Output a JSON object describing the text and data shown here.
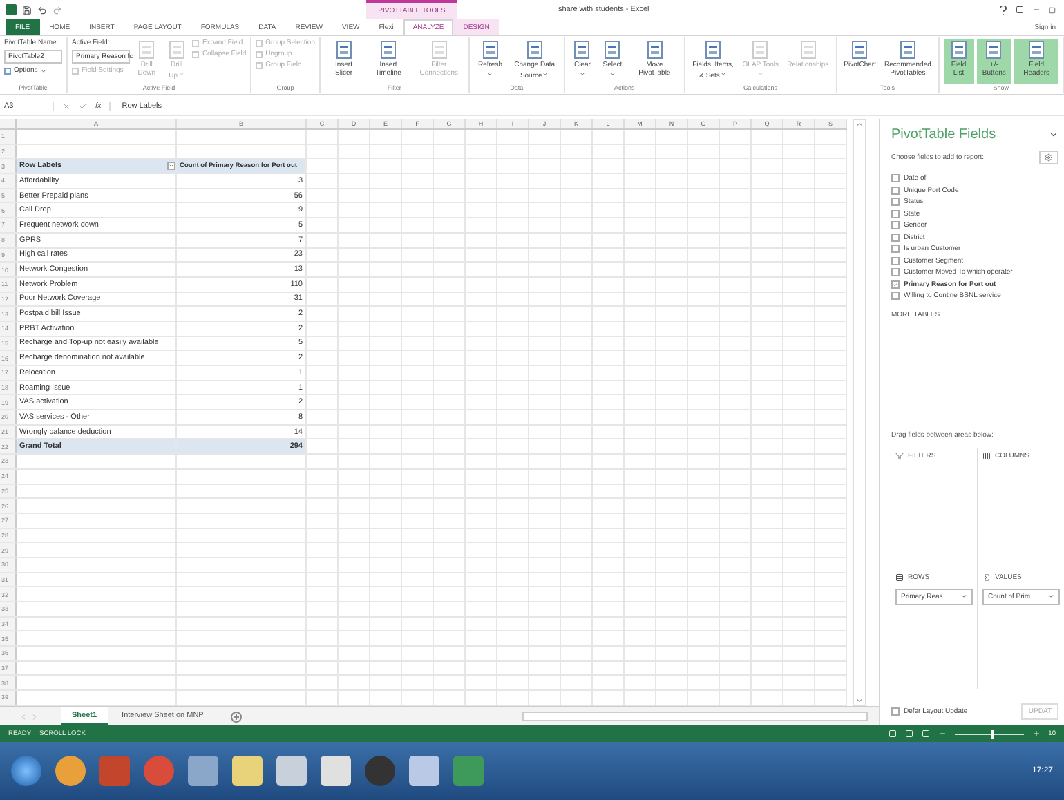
{
  "title_bar": {
    "context_tab": "PIVOTTABLE TOOLS",
    "title": "share with students - Excel"
  },
  "tabs": [
    {
      "label": "FILE",
      "kind": "file",
      "selected": false
    },
    {
      "label": "HOME",
      "kind": "plain",
      "selected": false
    },
    {
      "label": "INSERT",
      "kind": "plain",
      "selected": false
    },
    {
      "label": "PAGE LAYOUT",
      "kind": "plain",
      "selected": false
    },
    {
      "label": "FORMULAS",
      "kind": "plain",
      "selected": false
    },
    {
      "label": "DATA",
      "kind": "plain",
      "selected": false
    },
    {
      "label": "REVIEW",
      "kind": "plain",
      "selected": false
    },
    {
      "label": "VIEW",
      "kind": "plain",
      "selected": false
    },
    {
      "label": "Flexi",
      "kind": "plain",
      "selected": false
    },
    {
      "label": "ANALYZE",
      "kind": "context",
      "selected": true
    },
    {
      "label": "DESIGN",
      "kind": "context",
      "selected": false
    }
  ],
  "sign_in": "Sign in",
  "ribbon": [
    {
      "label": "PivotTable",
      "columns": [
        [
          {
            "kind": "caption",
            "label": "PivotTable Name:"
          },
          {
            "kind": "input",
            "label": "PivotTable2"
          },
          {
            "kind": "small",
            "label": "Options",
            "dropdown": true,
            "disabled": false
          }
        ]
      ]
    },
    {
      "label": "Active Field",
      "columns": [
        [
          {
            "kind": "caption",
            "label": "Active Field:"
          },
          {
            "kind": "input",
            "label": "Primary Reason fc"
          },
          {
            "kind": "small",
            "label": "Field Settings",
            "dropdown": false,
            "disabled": true
          }
        ],
        [
          {
            "kind": "large",
            "label": "Drill Down",
            "dropdown": false,
            "disabled": true
          }
        ],
        [
          {
            "kind": "large",
            "label": "Drill Up",
            "dropdown": true,
            "disabled": true
          }
        ],
        [
          {
            "kind": "small",
            "label": "Expand Field",
            "dropdown": false,
            "disabled": true
          },
          {
            "kind": "small",
            "label": "Collapse Field",
            "dropdown": false,
            "disabled": true
          }
        ]
      ]
    },
    {
      "label": "Group",
      "columns": [
        [
          {
            "kind": "small",
            "label": "Group Selection",
            "dropdown": false,
            "disabled": true
          },
          {
            "kind": "small",
            "label": "Ungroup",
            "dropdown": false,
            "disabled": true
          },
          {
            "kind": "small",
            "label": "Group Field",
            "dropdown": false,
            "disabled": true
          }
        ]
      ]
    },
    {
      "label": "Filter",
      "columns": [
        [
          {
            "kind": "large",
            "label": "Insert Slicer",
            "dropdown": false,
            "disabled": false
          }
        ],
        [
          {
            "kind": "large",
            "label": "Insert Timeline",
            "dropdown": false,
            "disabled": false
          }
        ],
        [
          {
            "kind": "large",
            "label": "Filter Connections",
            "dropdown": false,
            "disabled": true
          }
        ]
      ]
    },
    {
      "label": "Data",
      "columns": [
        [
          {
            "kind": "large",
            "label": "Refresh",
            "dropdown": true,
            "disabled": false
          }
        ],
        [
          {
            "kind": "large",
            "label": "Change Data Source",
            "dropdown": true,
            "disabled": false
          }
        ]
      ]
    },
    {
      "label": "Actions",
      "columns": [
        [
          {
            "kind": "large",
            "label": "Clear",
            "dropdown": true,
            "disabled": false
          }
        ],
        [
          {
            "kind": "large",
            "label": "Select",
            "dropdown": true,
            "disabled": false
          }
        ],
        [
          {
            "kind": "large",
            "label": "Move PivotTable",
            "dropdown": false,
            "disabled": false
          }
        ]
      ]
    },
    {
      "label": "Calculations",
      "columns": [
        [
          {
            "kind": "large",
            "label": "Fields, Items, & Sets",
            "dropdown": true,
            "disabled": false
          }
        ],
        [
          {
            "kind": "large",
            "label": "OLAP Tools",
            "dropdown": true,
            "disabled": true
          }
        ],
        [
          {
            "kind": "large",
            "label": "Relationships",
            "dropdown": false,
            "disabled": true
          }
        ]
      ]
    },
    {
      "label": "Tools",
      "columns": [
        [
          {
            "kind": "large",
            "label": "PivotChart",
            "dropdown": false,
            "disabled": false
          }
        ],
        [
          {
            "kind": "large",
            "label": "Recommended PivotTables",
            "dropdown": false,
            "disabled": false
          }
        ]
      ]
    },
    {
      "label": "Show",
      "columns": [
        [
          {
            "kind": "large",
            "label": "Field List",
            "dropdown": false,
            "disabled": false,
            "on": true
          }
        ],
        [
          {
            "kind": "large",
            "label": "+/- Buttons",
            "dropdown": false,
            "disabled": false,
            "on": true
          }
        ],
        [
          {
            "kind": "large",
            "label": "Field Headers",
            "dropdown": false,
            "disabled": false,
            "on": true
          }
        ]
      ]
    }
  ],
  "formula_bar": {
    "name_box": "A3",
    "fx": "fx",
    "value": "Row Labels"
  },
  "columns": [
    "A",
    "B",
    "C",
    "D",
    "E",
    "F",
    "G",
    "H",
    "I",
    "J",
    "K",
    "L",
    "M",
    "N",
    "O",
    "P",
    "Q",
    "R",
    "S"
  ],
  "rows": [
    {
      "number": "1",
      "kind": "blank"
    },
    {
      "number": "2",
      "kind": "blank"
    },
    {
      "number": "3",
      "kind": "header",
      "label": "Row Labels",
      "value": "Count of Primary Reason for Port out"
    },
    {
      "number": "4",
      "kind": "item",
      "label": "Affordability",
      "value": "3"
    },
    {
      "number": "5",
      "kind": "item",
      "label": "Better Prepaid plans",
      "value": "56"
    },
    {
      "number": "6",
      "kind": "item",
      "label": "Call Drop",
      "value": "9"
    },
    {
      "number": "7",
      "kind": "item",
      "label": "Frequent network down",
      "value": "5"
    },
    {
      "number": "8",
      "kind": "item",
      "label": "GPRS",
      "value": "7"
    },
    {
      "number": "9",
      "kind": "item",
      "label": "High call rates",
      "value": "23"
    },
    {
      "number": "10",
      "kind": "item",
      "label": "Network Congestion",
      "value": "13"
    },
    {
      "number": "11",
      "kind": "item",
      "label": "Network Problem",
      "value": "110"
    },
    {
      "number": "12",
      "kind": "item",
      "label": "Poor Network Coverage",
      "value": "31"
    },
    {
      "number": "13",
      "kind": "item",
      "label": "Postpaid bill Issue",
      "value": "2"
    },
    {
      "number": "14",
      "kind": "item",
      "label": "PRBT Activation",
      "value": "2"
    },
    {
      "number": "15",
      "kind": "item",
      "label": "Recharge and Top-up not easily available",
      "value": "5"
    },
    {
      "number": "16",
      "kind": "item",
      "label": "Recharge denomination not available",
      "value": "2"
    },
    {
      "number": "17",
      "kind": "item",
      "label": "Relocation",
      "value": "1"
    },
    {
      "number": "18",
      "kind": "item",
      "label": "Roaming Issue",
      "value": "1"
    },
    {
      "number": "19",
      "kind": "item",
      "label": "VAS activation",
      "value": "2"
    },
    {
      "number": "20",
      "kind": "item",
      "label": "VAS services - Other",
      "value": "8"
    },
    {
      "number": "21",
      "kind": "item",
      "label": "Wrongly balance deduction",
      "value": "14"
    },
    {
      "number": "22",
      "kind": "total",
      "label": "Grand Total",
      "value": "294"
    },
    {
      "number": "23",
      "kind": "blank"
    },
    {
      "number": "24",
      "kind": "blank"
    },
    {
      "number": "25",
      "kind": "blank"
    },
    {
      "number": "26",
      "kind": "blank"
    },
    {
      "number": "27",
      "kind": "blank"
    },
    {
      "number": "28",
      "kind": "blank"
    },
    {
      "number": "29",
      "kind": "blank"
    },
    {
      "number": "30",
      "kind": "blank"
    },
    {
      "number": "31",
      "kind": "blank"
    },
    {
      "number": "32",
      "kind": "blank"
    },
    {
      "number": "33",
      "kind": "blank"
    },
    {
      "number": "34",
      "kind": "blank"
    },
    {
      "number": "35",
      "kind": "blank"
    },
    {
      "number": "36",
      "kind": "blank"
    },
    {
      "number": "37",
      "kind": "blank"
    },
    {
      "number": "38",
      "kind": "blank"
    },
    {
      "number": "39",
      "kind": "blank"
    }
  ],
  "sheet_tabs": [
    {
      "label": "Sheet1",
      "selected": true
    },
    {
      "label": "Interview Sheet on MNP",
      "selected": false
    }
  ],
  "field_pane": {
    "title": "PivotTable Fields",
    "prompt": "Choose fields to add to report:",
    "fields": [
      {
        "label": "Date of",
        "checked": false
      },
      {
        "label": "Unique Port Code",
        "checked": false
      },
      {
        "label": "Status",
        "checked": false
      },
      {
        "label": "State",
        "checked": false
      },
      {
        "label": "Gender",
        "checked": false
      },
      {
        "label": "District",
        "checked": false
      },
      {
        "label": "Is urban Customer",
        "checked": false
      },
      {
        "label": "Customer Segment",
        "checked": false
      },
      {
        "label": "Customer Moved To which operater",
        "checked": false
      },
      {
        "label": "Primary Reason for Port out",
        "checked": true
      },
      {
        "label": "Willing to Contine BSNL service",
        "checked": false
      }
    ],
    "more_tables": "MORE TABLES...",
    "drag_hint": "Drag fields between areas below:",
    "areas": [
      {
        "kind": "filters",
        "label": "FILTERS"
      },
      {
        "kind": "columns",
        "label": "COLUMNS"
      },
      {
        "kind": "rows",
        "label": "ROWS",
        "chip": "Primary Reas..."
      },
      {
        "kind": "values",
        "label": "VALUES",
        "chip": "Count of Prim..."
      }
    ],
    "defer": {
      "label": "Defer Layout Update",
      "checked": false
    },
    "update_button": "UPDAT"
  },
  "status_bar": {
    "items": [
      "READY",
      "SCROLL LOCK"
    ],
    "zoom_slider": {
      "level": 0.55
    },
    "zoom": "10"
  },
  "taskbar": {
    "time": "17:27"
  }
}
